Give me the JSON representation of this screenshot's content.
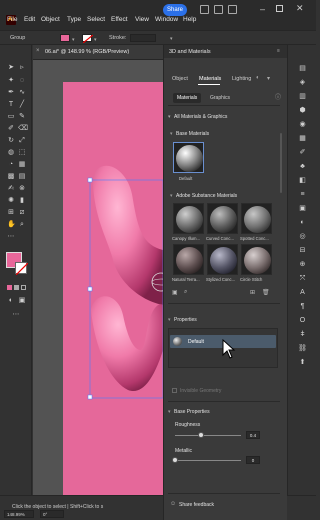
{
  "app": {
    "logo": "Ai"
  },
  "menubar": {
    "items": [
      "File",
      "Edit",
      "Object",
      "Type",
      "Select",
      "Effect",
      "View",
      "Window",
      "Help"
    ],
    "share_label": "Share"
  },
  "controlbar": {
    "selection_label": "Group",
    "stroke_label": "Stroke:",
    "fill_color": "#e8679a"
  },
  "document": {
    "tab_title": "06.ai* @ 148.99 % (RGB/Preview)"
  },
  "panel": {
    "title": "3D and Materials",
    "tabs": [
      "Object",
      "Materials",
      "Lighting"
    ],
    "active_tab": "Materials",
    "subtabs": [
      "Materials",
      "Graphics"
    ],
    "all_section": "All Materials & Graphics",
    "base_materials_label": "Base Materials",
    "base_items": [
      {
        "label": "Default"
      }
    ],
    "substance_label": "Adobe Substance Materials",
    "substance_items": [
      {
        "label": "Canopy Illum..."
      },
      {
        "label": "Curved Conc..."
      },
      {
        "label": "Spotted Conc..."
      },
      {
        "label": "Natural Terra..."
      },
      {
        "label": "Stylized Conc..."
      },
      {
        "label": "Circle Stitch"
      }
    ],
    "properties_label": "Properties",
    "selected_material": "Default",
    "invisible_geometry_label": "Invisible Geometry",
    "base_properties_label": "Base Properties",
    "roughness_label": "Roughness",
    "roughness_value": "0.4",
    "roughness": 0.4,
    "metallic_label": "Metallic",
    "metallic_value": "0",
    "metallic": 0,
    "share_feedback_label": "Share feedback"
  },
  "statusbar": {
    "zoom": "148.99%",
    "angle": "0°",
    "hint": "Click the object to select | Shift+Click to s"
  },
  "colors": {
    "artboard": "#e5689a",
    "accent": "#2b70e8",
    "selection": "#4b5b6b"
  }
}
